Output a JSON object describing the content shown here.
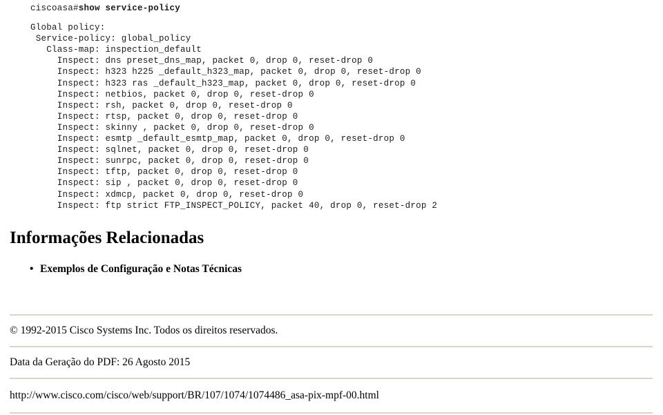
{
  "console": {
    "prompt": "ciscoasa#",
    "command": "show service-policy",
    "lines": [
      "Global policy:",
      " Service-policy: global_policy",
      "   Class-map: inspection_default",
      "     Inspect: dns preset_dns_map, packet 0, drop 0, reset-drop 0",
      "     Inspect: h323 h225 _default_h323_map, packet 0, drop 0, reset-drop 0",
      "     Inspect: h323 ras _default_h323_map, packet 0, drop 0, reset-drop 0",
      "     Inspect: netbios, packet 0, drop 0, reset-drop 0",
      "     Inspect: rsh, packet 0, drop 0, reset-drop 0",
      "     Inspect: rtsp, packet 0, drop 0, reset-drop 0",
      "     Inspect: skinny , packet 0, drop 0, reset-drop 0",
      "     Inspect: esmtp _default_esmtp_map, packet 0, drop 0, reset-drop 0",
      "     Inspect: sqlnet, packet 0, drop 0, reset-drop 0",
      "     Inspect: sunrpc, packet 0, drop 0, reset-drop 0",
      "     Inspect: tftp, packet 0, drop 0, reset-drop 0",
      "     Inspect: sip , packet 0, drop 0, reset-drop 0",
      "     Inspect: xdmcp, packet 0, drop 0, reset-drop 0",
      "     Inspect: ftp strict FTP_INSPECT_POLICY, packet 40, drop 0, reset-drop 2"
    ]
  },
  "related": {
    "heading": "Informações Relacionadas",
    "items": [
      {
        "bullet": "•",
        "label": "Exemplos de Configuração e Notas Técnicas"
      }
    ]
  },
  "footer": {
    "copyright": "© 1992-2015 Cisco Systems Inc. Todos os direitos reservados.",
    "generation_date": "Data da Geração do PDF: 26 Agosto 2015",
    "url": "http://www.cisco.com/cisco/web/support/BR/107/1074/1074486_asa-pix-mpf-00.html"
  },
  "colors": {
    "rule": "#d8d6c4",
    "text": "#000000",
    "console_text": "#1a1a1a",
    "background": "#ffffff"
  }
}
